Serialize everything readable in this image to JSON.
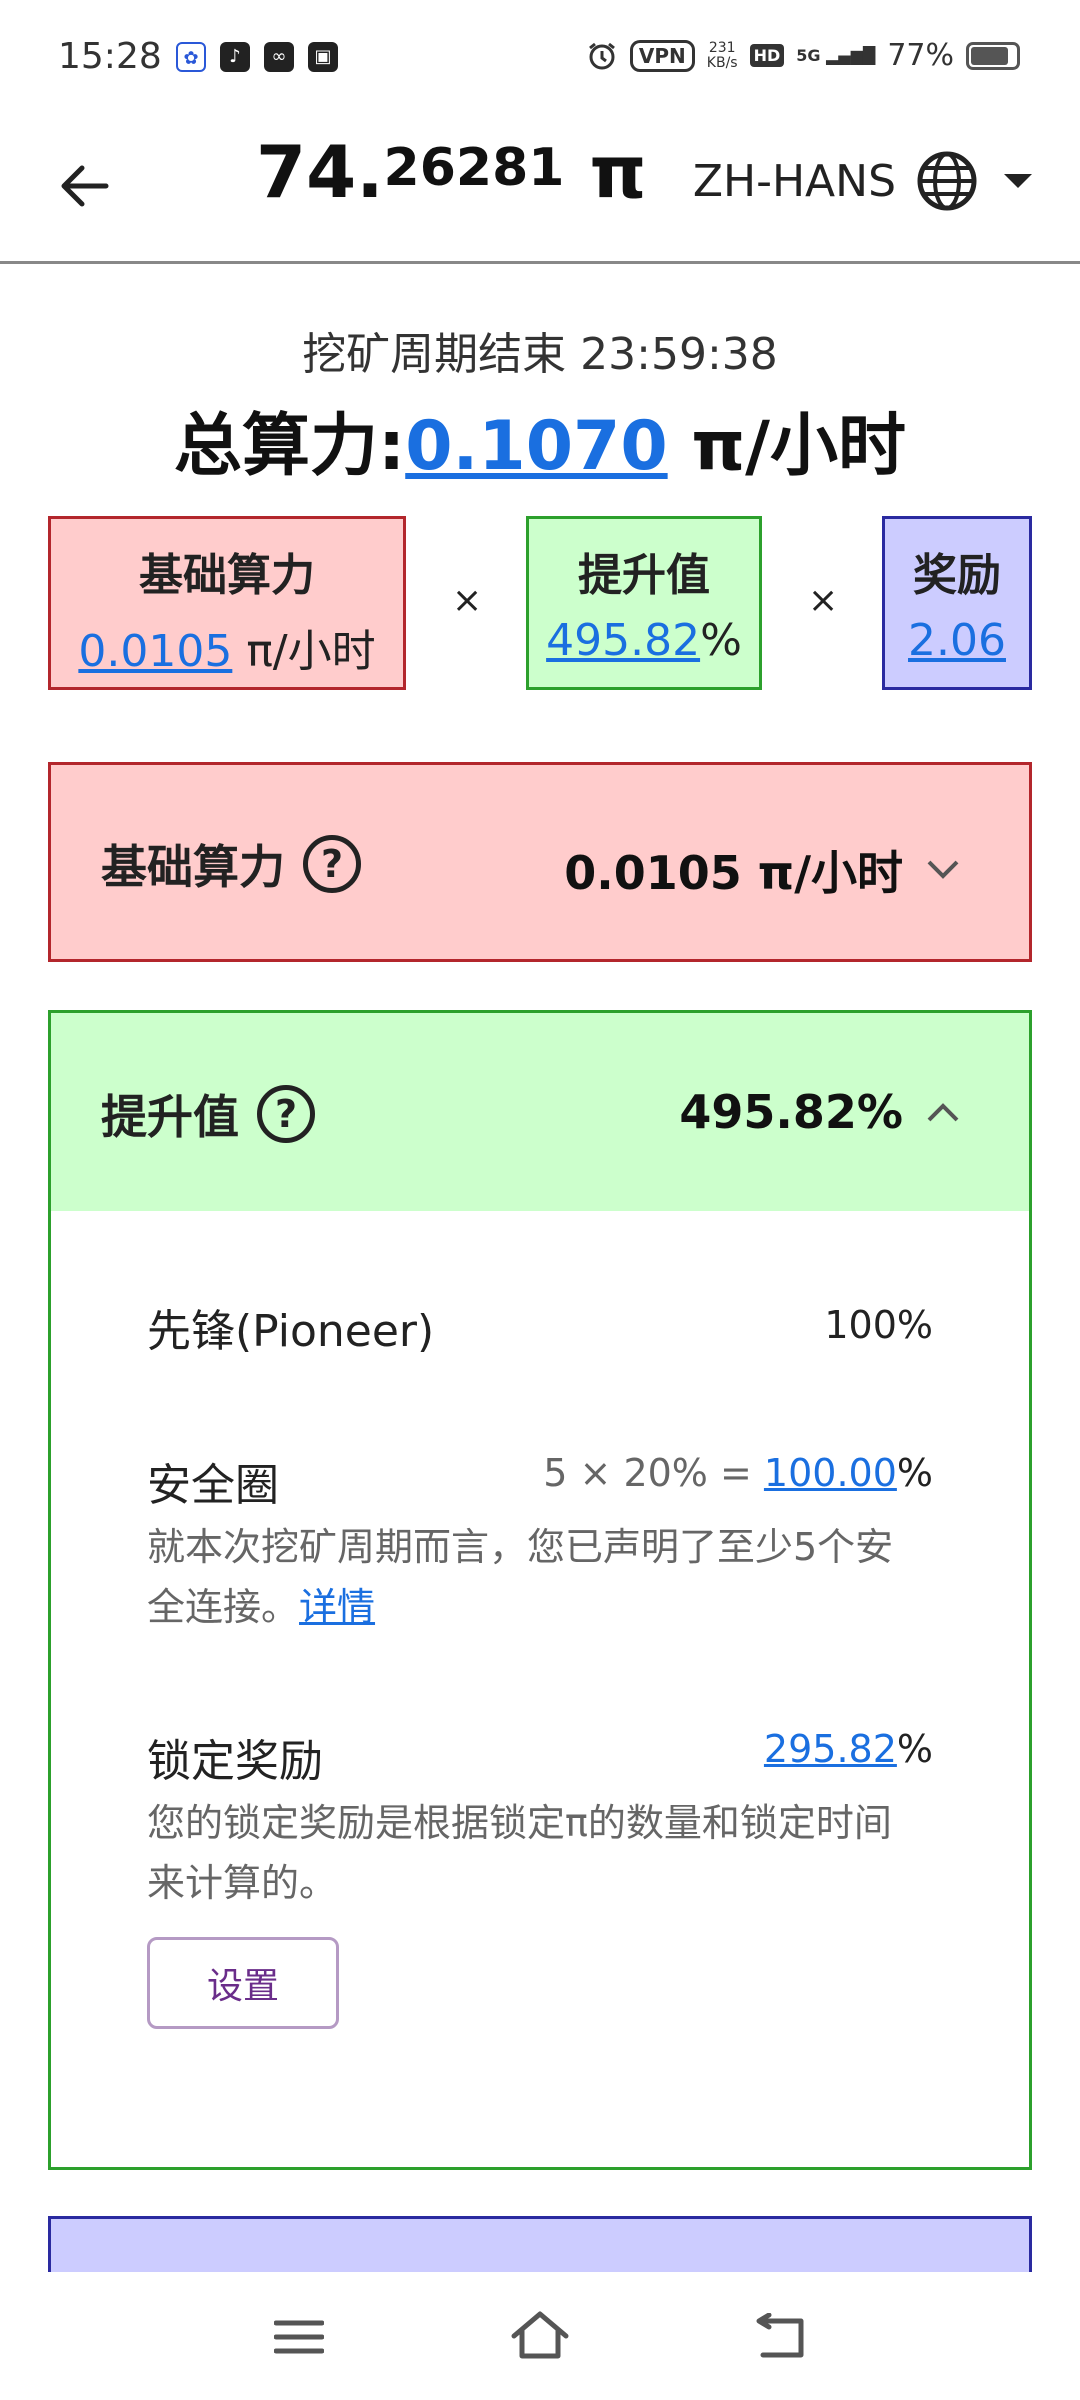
{
  "status_bar": {
    "time": "15:28",
    "vpn": "VPN",
    "speed_value": "231",
    "speed_unit": "KB/s",
    "hd": "HD",
    "network": "5G",
    "battery_percent": "77%",
    "battery_level": 0.77
  },
  "header": {
    "balance_int": "74.",
    "balance_frac": "26281",
    "balance_unit": " π",
    "language": "ZH-HANS"
  },
  "summary": {
    "cycle_text": "挖矿周期结束 23:59:38",
    "total_label": "总算力:",
    "total_value": "0.1070",
    "total_unit": " π/小时",
    "multiply": "×",
    "base": {
      "title": "基础算力",
      "value": "0.0105",
      "unit": " π/小时"
    },
    "boost": {
      "title": "提升值",
      "value": "495.82",
      "unit": "%"
    },
    "reward": {
      "title": "奖励",
      "value": "2.06"
    }
  },
  "base_panel": {
    "title": "基础算力",
    "help": "?",
    "value": "0.0105 π/小时"
  },
  "boost_panel": {
    "title": "提升值",
    "help": "?",
    "value": "495.82%",
    "items": [
      {
        "label": "先锋(Pioneer)",
        "value": "100%"
      },
      {
        "label": "安全圈",
        "formula": "5 × 20% = ",
        "value": "100.00",
        "unit": "%",
        "desc": "就本次挖矿周期而言，您已声明了至少5个安全连接。",
        "link": "详情"
      },
      {
        "label": "锁定奖励",
        "value": "295.82",
        "unit": "%",
        "desc": "您的锁定奖励是根据锁定π的数量和锁定时间来计算的。",
        "button": "设置"
      }
    ]
  }
}
